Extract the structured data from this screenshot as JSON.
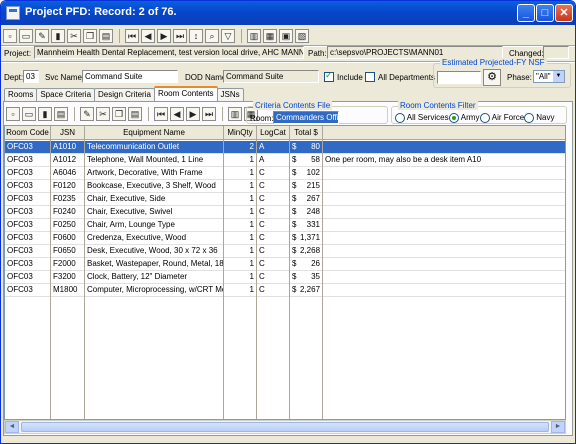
{
  "window": {
    "title": "Project PFD: Record: 2 of 76.",
    "minimize": "_",
    "maximize": "□",
    "close": "✕"
  },
  "toolbar": {
    "icons": [
      "new-icon",
      "open-icon",
      "edit-icon",
      "delete-icon",
      "cut-icon",
      "copy-icon",
      "paste-icon",
      "first-record-icon",
      "previous-record-icon",
      "next-record-icon",
      "last-record-icon",
      "sort-icon",
      "find-icon",
      "filter-icon",
      "report-icon",
      "spreadsheet-icon",
      "calculator-icon",
      "exit-icon"
    ]
  },
  "project": {
    "project_label": "Project:",
    "project_value": "Mannheim Health Dental Replacement, test version local drive, AHC MANNHEIM",
    "path_label": "Path:",
    "path_value": "c:\\sepsvo\\PROJECTS\\MANN01",
    "changed_label": "Changed:",
    "changed_value": ""
  },
  "dept": {
    "dept_label": "Dept:",
    "dept_value": "03",
    "svc_label": "Svc Name:",
    "svc_value": "Command Suite",
    "dod_label": "DOD Name:",
    "dod_value": "Command Suite",
    "include_label": "Include",
    "include_checked": true,
    "all_depts_label": "All Departments",
    "all_depts_checked": false
  },
  "projected": {
    "title": "Estimated Projected-FY NSF",
    "value": "",
    "phase_label": "Phase:",
    "phase_value": "\"All\""
  },
  "tabs": [
    {
      "label": "Rooms",
      "active": false
    },
    {
      "label": "Space Criteria",
      "active": false
    },
    {
      "label": "Design Criteria",
      "active": false
    },
    {
      "label": "Room Contents",
      "active": true
    },
    {
      "label": "JSNs",
      "active": false
    }
  ],
  "criteria_file": {
    "title": "Criteria Contents File",
    "room_label": "Room:",
    "room_value": "Commanders Office"
  },
  "filter": {
    "title": "Room Contents Filter",
    "options": [
      {
        "label": "All Services",
        "selected": false
      },
      {
        "label": "Army",
        "selected": true
      },
      {
        "label": "Air Force",
        "selected": false
      },
      {
        "label": "Navy",
        "selected": false
      }
    ]
  },
  "grid": {
    "columns": [
      "Room Code",
      "JSN",
      "Equipment Name",
      "MinQty",
      "LogCat",
      "Total $",
      ""
    ],
    "rows": [
      {
        "room_code": "OFC03",
        "jsn": "A1010",
        "name": "Telecommunication Outlet",
        "qty": "2",
        "logcat": "A",
        "cur": "$",
        "total": "80",
        "note": "",
        "selected": true
      },
      {
        "room_code": "OFC03",
        "jsn": "A1012",
        "name": "Telephone, Wall Mounted, 1 Line",
        "qty": "1",
        "logcat": "A",
        "cur": "$",
        "total": "58",
        "note": "One per room, may also be a desk item A10",
        "selected": false
      },
      {
        "room_code": "OFC03",
        "jsn": "A6046",
        "name": "Artwork, Decorative, With Frame",
        "qty": "1",
        "logcat": "C",
        "cur": "$",
        "total": "102",
        "note": "",
        "selected": false
      },
      {
        "room_code": "OFC03",
        "jsn": "F0120",
        "name": "Bookcase, Executive, 3 Shelf, Wood",
        "qty": "1",
        "logcat": "C",
        "cur": "$",
        "total": "215",
        "note": "",
        "selected": false
      },
      {
        "room_code": "OFC03",
        "jsn": "F0235",
        "name": "Chair, Executive, Side",
        "qty": "1",
        "logcat": "C",
        "cur": "$",
        "total": "267",
        "note": "",
        "selected": false
      },
      {
        "room_code": "OFC03",
        "jsn": "F0240",
        "name": "Chair, Executive, Swivel",
        "qty": "1",
        "logcat": "C",
        "cur": "$",
        "total": "248",
        "note": "",
        "selected": false
      },
      {
        "room_code": "OFC03",
        "jsn": "F0250",
        "name": "Chair, Arm, Lounge Type",
        "qty": "1",
        "logcat": "C",
        "cur": "$",
        "total": "331",
        "note": "",
        "selected": false
      },
      {
        "room_code": "OFC03",
        "jsn": "F0600",
        "name": "Credenza, Executive, Wood",
        "qty": "1",
        "logcat": "C",
        "cur": "$",
        "total": "1,371",
        "note": "",
        "selected": false
      },
      {
        "room_code": "OFC03",
        "jsn": "F0650",
        "name": "Desk, Executive, Wood, 30 x 72 x 36",
        "qty": "1",
        "logcat": "C",
        "cur": "$",
        "total": "2,268",
        "note": "",
        "selected": false
      },
      {
        "room_code": "OFC03",
        "jsn": "F2000",
        "name": "Basket, Wastepaper, Round, Metal, 18",
        "qty": "1",
        "logcat": "C",
        "cur": "$",
        "total": "26",
        "note": "",
        "selected": false
      },
      {
        "room_code": "OFC03",
        "jsn": "F3200",
        "name": "Clock, Battery, 12\" Diameter",
        "qty": "1",
        "logcat": "C",
        "cur": "$",
        "total": "35",
        "note": "",
        "selected": false
      },
      {
        "room_code": "OFC03",
        "jsn": "M1800",
        "name": "Computer, Microprocessing, w/CRT  Mo",
        "qty": "1",
        "logcat": "C",
        "cur": "$",
        "total": "2,267",
        "note": "",
        "selected": false
      }
    ]
  },
  "scrollbar": {
    "left": "◄",
    "right": "►"
  }
}
